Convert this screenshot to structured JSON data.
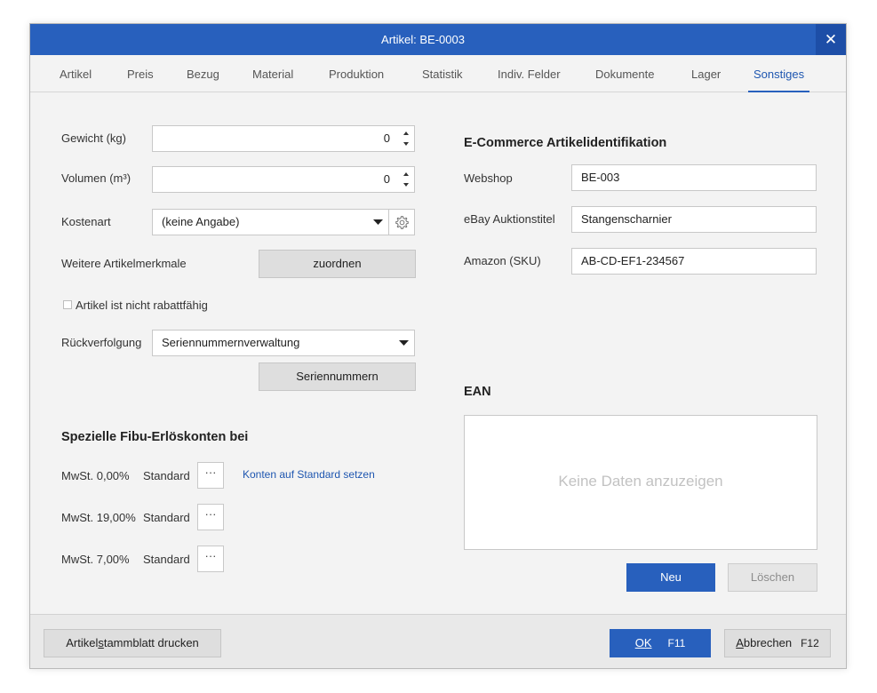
{
  "window": {
    "title": "Artikel: BE-0003",
    "close_symbol": "✕"
  },
  "tabs": [
    {
      "label": "Artikel"
    },
    {
      "label": "Preis"
    },
    {
      "label": "Bezug"
    },
    {
      "label": "Material"
    },
    {
      "label": "Produktion"
    },
    {
      "label": "Statistik"
    },
    {
      "label": "Indiv. Felder"
    },
    {
      "label": "Dokumente"
    },
    {
      "label": "Lager"
    },
    {
      "label": "Sonstiges",
      "active": true
    }
  ],
  "left": {
    "weight": {
      "label": "Gewicht (kg)",
      "value": "0"
    },
    "volume": {
      "label": "Volumen (m³)",
      "value": "0"
    },
    "cost_type": {
      "label": "Kostenart",
      "value": "(keine Angabe)"
    },
    "more_features": {
      "label": "Weitere Artikelmerkmale",
      "button": "zuordnen"
    },
    "no_discount": {
      "label": "Artikel ist nicht rabattfähig",
      "checked": false
    },
    "tracking": {
      "label": "Rückverfolgung",
      "value": "Seriennummernverwaltung",
      "button": "Seriennummern"
    },
    "fibu": {
      "heading": "Spezielle Fibu-Erlöskonten bei",
      "reset_link": "Konten auf Standard setzen",
      "rows": [
        {
          "vat": "MwSt. 0,00%",
          "value": "Standard",
          "button": "···"
        },
        {
          "vat": "MwSt. 19,00%",
          "value": "Standard",
          "button": "···"
        },
        {
          "vat": "MwSt. 7,00%",
          "value": "Standard",
          "button": "···"
        }
      ]
    }
  },
  "right": {
    "ecommerce": {
      "heading": "E-Commerce Artikelidentifikation",
      "webshop": {
        "label": "Webshop",
        "value": "BE-003"
      },
      "ebay": {
        "label": "eBay Auktionstitel",
        "value": "Stangenscharnier"
      },
      "amazon": {
        "label": "Amazon (SKU)",
        "value": "AB-CD-EF1-234567"
      }
    },
    "ean": {
      "heading": "EAN",
      "empty_text": "Keine Daten anzuzeigen",
      "new_button": "Neu",
      "delete_button": "Löschen"
    }
  },
  "footer": {
    "print_prefix": "Artikel",
    "print_underlined": "s",
    "print_suffix": "tammblatt drucken",
    "ok_label": "OK",
    "ok_shortcut": "F11",
    "cancel_underlined": "A",
    "cancel_suffix": "bbrechen",
    "cancel_shortcut": "F12"
  },
  "colors": {
    "accent": "#2860bd",
    "link": "#1e56b0",
    "background": "#f3f3f3"
  },
  "icons": {
    "settings": "gear-icon",
    "dropdown": "chevron-down-icon",
    "spinner": "spinner-arrows-icon"
  }
}
